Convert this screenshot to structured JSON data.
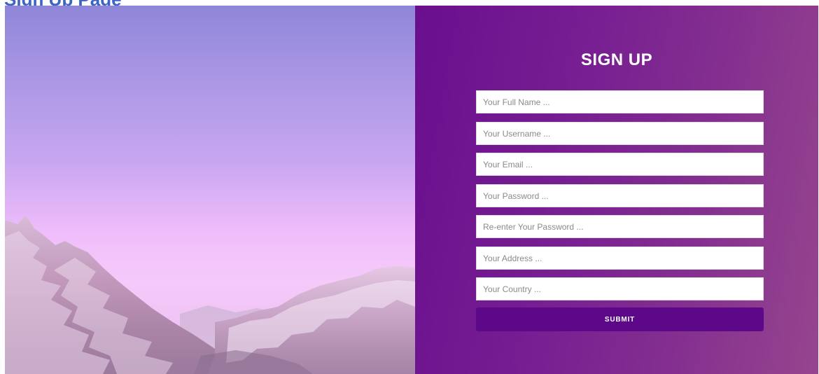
{
  "page": {
    "heading": "Sign Up Page"
  },
  "hero_image": {
    "description_icon": "mountain-landscape-image",
    "colors": {
      "sky_top": "#8f86d8",
      "sky_bottom": "#f6c8fb",
      "mountain": "#a9789f"
    }
  },
  "form": {
    "title": "SIGN UP",
    "background": "#6a0f8e",
    "fields": [
      {
        "name": "full-name-field",
        "placeholder": "Your Full Name ...",
        "value": ""
      },
      {
        "name": "username-field",
        "placeholder": "Your Username ...",
        "value": ""
      },
      {
        "name": "email-field",
        "placeholder": "Your Email ...",
        "value": ""
      },
      {
        "name": "password-field",
        "placeholder": "Your Password ...",
        "value": ""
      },
      {
        "name": "confirm-password-field",
        "placeholder": "Re-enter Your Password ...",
        "value": ""
      },
      {
        "name": "address-field",
        "placeholder": "Your Address ...",
        "value": ""
      },
      {
        "name": "country-field",
        "placeholder": "Your Country ...",
        "value": ""
      }
    ],
    "submit_label": "SUBMIT",
    "submit_color": "#5c0888"
  }
}
